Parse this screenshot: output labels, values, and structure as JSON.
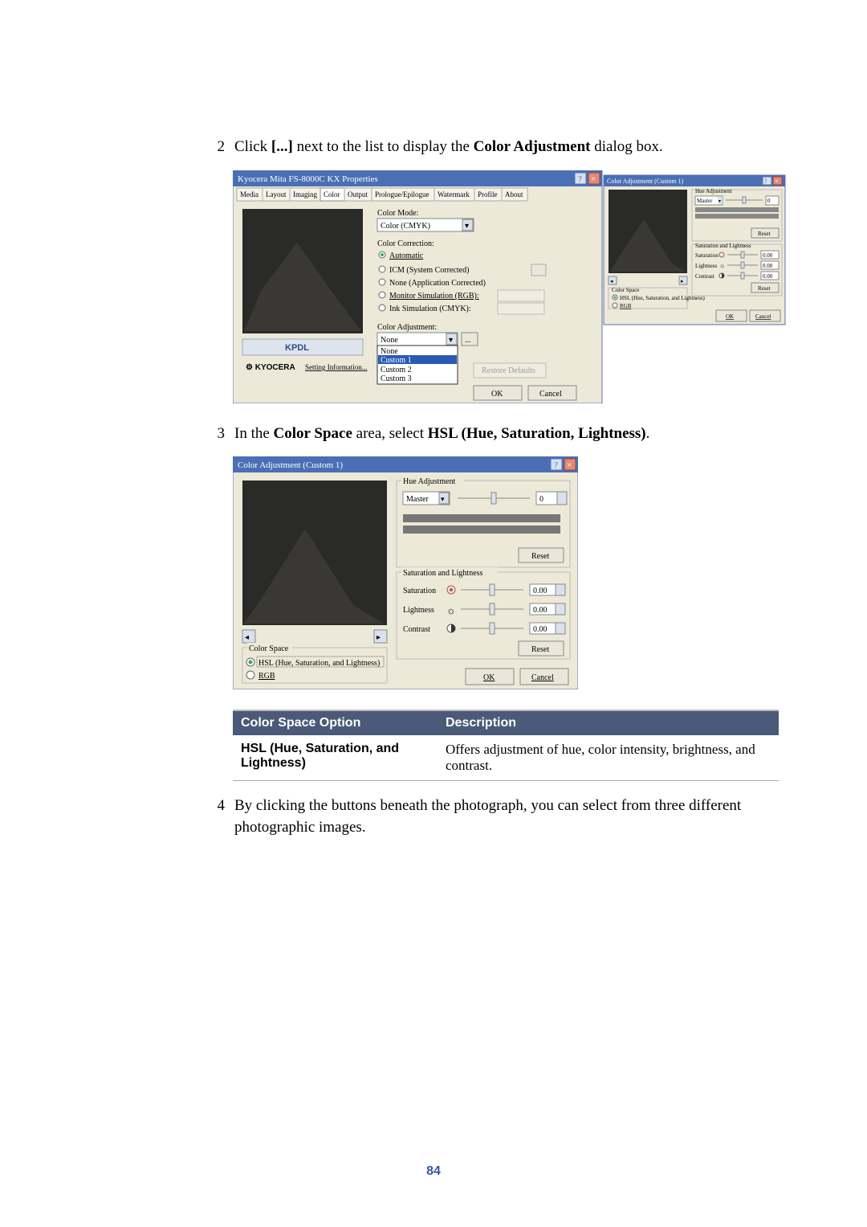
{
  "step2": {
    "num": "2",
    "pre": "Click ",
    "bold": "[...]",
    "mid": " next to the list to display the ",
    "bold2": "Color Adjustment",
    "post": " dialog box."
  },
  "step3": {
    "num": "3",
    "pre": "In the ",
    "bold": "Color Space",
    "mid": " area, select ",
    "bold2": "HSL (Hue, Saturation, Lightness)",
    "post": "."
  },
  "step4": {
    "num": "4",
    "txt": "By clicking the buttons beneath the photograph, you can select from three different photographic images."
  },
  "table": {
    "h1": "Color Space Option",
    "h2": "Description",
    "r1_opt": "HSL (Hue, Saturation, and Lightness)",
    "r1_desc": "Offers adjustment of hue, color intensity, brightness, and contrast."
  },
  "shot1": {
    "title": "Kyocera Mita FS-8000C KX Properties",
    "tabs": [
      "Media",
      "Layout",
      "Imaging",
      "Color",
      "Output",
      "Prologue/Epilogue",
      "Watermark",
      "Profile",
      "About"
    ],
    "colorMode": "Color Mode:",
    "colorModeVal": "Color (CMYK)",
    "colorCorr": "Color Correction:",
    "auto": "Automatic",
    "icm": "ICM (System Corrected)",
    "none": "None (Application Corrected)",
    "mon": "Monitor Simulation (RGB):",
    "ink": "Ink Simulation (CMYK):",
    "colorAdj": "Color Adjustment:",
    "caVal": "None",
    "drop": [
      "None",
      "Custom 1",
      "Custom 2",
      "Custom 3"
    ],
    "brand": "KPDL",
    "vendor": "KYOCERA",
    "settings": "Setting Information...",
    "restore": "Restore Defaults",
    "ok": "OK",
    "cancel": "Cancel",
    "ca_title": "Color Adjustment (Custom 1)",
    "hue": "Hue Adjustment",
    "master": "Master",
    "reset": "Reset",
    "sat_group": "Saturation and Lightness",
    "sat": "Saturation",
    "light": "Lightness",
    "contrast": "Contrast",
    "cs": "Color Space",
    "hsl": "HSL (Hue, Saturation, and Lightness)",
    "rgb": "RGB",
    "v0": "0",
    "v000": "0.00"
  },
  "shot2": {
    "title": "Color Adjustment (Custom 1)",
    "hue": "Hue Adjustment",
    "master": "Master",
    "reset": "Reset",
    "sat_group": "Saturation and Lightness",
    "sat": "Saturation",
    "light": "Lightness",
    "contrast": "Contrast",
    "cs": "Color Space",
    "hsl": "HSL (Hue, Saturation, and Lightness)",
    "rgb": "RGB",
    "ok": "OK",
    "cancel": "Cancel",
    "v0": "0",
    "v000": "0.00"
  },
  "page": "84"
}
